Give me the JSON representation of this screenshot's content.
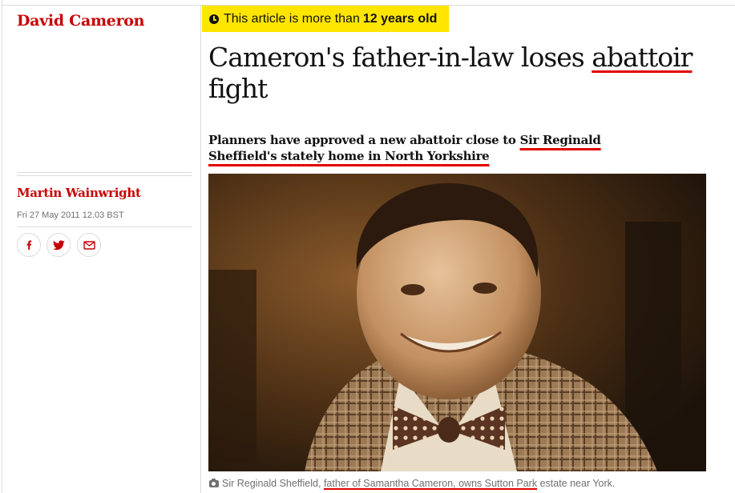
{
  "section": {
    "label": "David Cameron"
  },
  "age_notice": {
    "prefix": "This article is more than",
    "age": "12 years old"
  },
  "article": {
    "headline_start": "Cameron's father-in-law loses",
    "headline_highlight": "abattoir",
    "headline_end": "fight",
    "standfirst_start": "Planners have approved a new abattoir close to",
    "standfirst_link": "Sir Reginald Sheffield's stately home in North Yorkshire"
  },
  "meta": {
    "author": "Martin Wainwright",
    "date": "Fri 27 May 2011 12.03 BST"
  },
  "share": [
    {
      "name": "facebook-icon"
    },
    {
      "name": "twitter-icon"
    },
    {
      "name": "email-icon"
    }
  ],
  "image": {
    "subject": "sepia portrait of a smiling man in a checked jacket and polka-dot bow tie"
  },
  "caption": {
    "start": "Sir Reginald Sheffield,",
    "highlight": "father of Samantha Cameron, owns Sutton Park",
    "end": "estate near York."
  },
  "colors": {
    "accent": "#c70000",
    "badge": "#ffe500",
    "underline": "#e00000",
    "text": "#121212",
    "muted": "#707070"
  }
}
